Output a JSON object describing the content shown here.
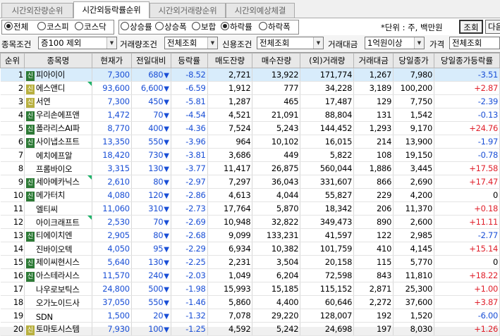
{
  "tabs": [
    {
      "label": "시간외잔량순위",
      "active": false
    },
    {
      "label": "시간외등락률순위",
      "active": true
    },
    {
      "label": "시간외거래량순위",
      "active": false
    },
    {
      "label": "시간외예상체결",
      "active": false
    }
  ],
  "market_radios": [
    {
      "label": "전체",
      "checked": true
    },
    {
      "label": "코스피",
      "checked": false
    },
    {
      "label": "코스닥",
      "checked": false
    }
  ],
  "sort_radios": [
    {
      "label": "상승률",
      "checked": false
    },
    {
      "label": "상승폭",
      "checked": false
    },
    {
      "label": "보합",
      "checked": false
    },
    {
      "label": "하락률",
      "checked": true
    },
    {
      "label": "하락폭",
      "checked": false
    }
  ],
  "unit_text": "*단위 : 주, 백만원",
  "query_button": "조회",
  "next_button": "다음",
  "filters": {
    "stock_cond_label": "종목조건",
    "stock_cond_value": "증100 제외",
    "volume_cond_label": "거래량조건",
    "volume_cond_value": "전체조회",
    "credit_cond_label": "신용조건",
    "credit_cond_value": "전체조회",
    "amount_label": "거래대금",
    "amount_value": "1억원이상",
    "price_label": "가격",
    "price_value": "전체조회"
  },
  "columns": [
    "순위",
    "종목명",
    "현재가",
    "전일대비",
    "등락률",
    "매도잔량",
    "매수잔량",
    "(외)거래량",
    "거래대금",
    "당일종가",
    "당일종가등락률"
  ],
  "rows": [
    {
      "rank": "1",
      "badge": "신",
      "badge_style": "dark",
      "name": "피아이이",
      "corner": false,
      "price": "7,300",
      "chg": "680",
      "rate": "-8.52",
      "ask": "2,721",
      "bid": "13,922",
      "vol": "171,774",
      "amt": "1,267",
      "close": "7,980",
      "close_rate": "-3.51",
      "close_color": "blue"
    },
    {
      "rank": "2",
      "badge": "신",
      "badge_style": "light",
      "name": "에스앤디",
      "corner": true,
      "price": "93,600",
      "chg": "6,600",
      "rate": "-6.59",
      "ask": "1,912",
      "bid": "777",
      "vol": "34,228",
      "amt": "3,189",
      "close": "100,200",
      "close_rate": "+2.87",
      "close_color": "red"
    },
    {
      "rank": "3",
      "badge": "신",
      "badge_style": "light",
      "name": "서연",
      "corner": false,
      "price": "7,300",
      "chg": "450",
      "rate": "-5.81",
      "ask": "1,287",
      "bid": "465",
      "vol": "17,487",
      "amt": "129",
      "close": "7,750",
      "close_rate": "-2.39",
      "close_color": "blue"
    },
    {
      "rank": "4",
      "badge": "신",
      "badge_style": "dark",
      "name": "우리손에프앤",
      "corner": false,
      "price": "1,472",
      "chg": "70",
      "rate": "-4.54",
      "ask": "4,521",
      "bid": "21,091",
      "vol": "88,804",
      "amt": "131",
      "close": "1,542",
      "close_rate": "-0.13",
      "close_color": "blue"
    },
    {
      "rank": "5",
      "badge": "신",
      "badge_style": "dark",
      "name": "폴라리스AI파",
      "corner": false,
      "price": "8,770",
      "chg": "400",
      "rate": "-4.36",
      "ask": "7,524",
      "bid": "5,243",
      "vol": "144,452",
      "amt": "1,293",
      "close": "9,170",
      "close_rate": "+24.76",
      "close_color": "red"
    },
    {
      "rank": "6",
      "badge": "신",
      "badge_style": "dark",
      "name": "사이냅소프트",
      "corner": false,
      "price": "13,350",
      "chg": "550",
      "rate": "-3.96",
      "ask": "964",
      "bid": "10,102",
      "vol": "16,015",
      "amt": "214",
      "close": "13,900",
      "close_rate": "-1.97",
      "close_color": "blue"
    },
    {
      "rank": "7",
      "badge": "",
      "badge_style": "",
      "name": "에치에프알",
      "corner": false,
      "price": "18,420",
      "chg": "730",
      "rate": "-3.81",
      "ask": "3,686",
      "bid": "449",
      "vol": "5,822",
      "amt": "108",
      "close": "19,150",
      "close_rate": "-0.78",
      "close_color": "blue"
    },
    {
      "rank": "8",
      "badge": "",
      "badge_style": "",
      "name": "프롬바이오",
      "corner": false,
      "price": "3,315",
      "chg": "130",
      "rate": "-3.77",
      "ask": "11,417",
      "bid": "26,875",
      "vol": "560,044",
      "amt": "1,886",
      "close": "3,445",
      "close_rate": "+17.58",
      "close_color": "red"
    },
    {
      "rank": "9",
      "badge": "신",
      "badge_style": "dark",
      "name": "세아메카닉스",
      "corner": true,
      "price": "2,610",
      "chg": "80",
      "rate": "-2.97",
      "ask": "7,297",
      "bid": "36,043",
      "vol": "331,607",
      "amt": "866",
      "close": "2,690",
      "close_rate": "+17.47",
      "close_color": "red"
    },
    {
      "rank": "10",
      "badge": "신",
      "badge_style": "dark",
      "name": "메가터치",
      "corner": false,
      "price": "4,080",
      "chg": "120",
      "rate": "-2.86",
      "ask": "4,613",
      "bid": "4,044",
      "vol": "55,827",
      "amt": "229",
      "close": "4,200",
      "close_rate": "0",
      "close_color": "black"
    },
    {
      "rank": "11",
      "badge": "",
      "badge_style": "",
      "name": "엘티씨",
      "corner": false,
      "price": "11,060",
      "chg": "310",
      "rate": "-2.73",
      "ask": "17,764",
      "bid": "5,870",
      "vol": "18,342",
      "amt": "206",
      "close": "11,370",
      "close_rate": "+0.18",
      "close_color": "red"
    },
    {
      "rank": "12",
      "badge": "",
      "badge_style": "",
      "name": "아이크래프트",
      "corner": true,
      "price": "2,530",
      "chg": "70",
      "rate": "-2.69",
      "ask": "10,948",
      "bid": "32,822",
      "vol": "349,473",
      "amt": "890",
      "close": "2,600",
      "close_rate": "+11.11",
      "close_color": "red"
    },
    {
      "rank": "13",
      "badge": "신",
      "badge_style": "dark",
      "name": "티에이치엔",
      "corner": false,
      "price": "2,905",
      "chg": "80",
      "rate": "-2.68",
      "ask": "9,099",
      "bid": "133,231",
      "vol": "41,597",
      "amt": "122",
      "close": "2,985",
      "close_rate": "-2.77",
      "close_color": "blue"
    },
    {
      "rank": "14",
      "badge": "",
      "badge_style": "",
      "name": "진바이오텍",
      "corner": false,
      "price": "4,050",
      "chg": "95",
      "rate": "-2.29",
      "ask": "6,934",
      "bid": "10,382",
      "vol": "101,759",
      "amt": "410",
      "close": "4,145",
      "close_rate": "+15.14",
      "close_color": "red"
    },
    {
      "rank": "15",
      "badge": "신",
      "badge_style": "dark",
      "name": "제이씨현시스",
      "corner": false,
      "price": "5,640",
      "chg": "130",
      "rate": "-2.25",
      "ask": "2,231",
      "bid": "3,504",
      "vol": "20,158",
      "amt": "115",
      "close": "5,770",
      "close_rate": "0",
      "close_color": "black"
    },
    {
      "rank": "16",
      "badge": "신",
      "badge_style": "dark",
      "name": "아스테라시스",
      "corner": false,
      "price": "11,570",
      "chg": "240",
      "rate": "-2.03",
      "ask": "1,049",
      "bid": "6,204",
      "vol": "72,598",
      "amt": "843",
      "close": "11,810",
      "close_rate": "+18.22",
      "close_color": "red"
    },
    {
      "rank": "17",
      "badge": "",
      "badge_style": "",
      "name": "나우로보틱스",
      "corner": false,
      "price": "24,800",
      "chg": "500",
      "rate": "-1.98",
      "ask": "15,993",
      "bid": "15,185",
      "vol": "115,152",
      "amt": "2,871",
      "close": "25,300",
      "close_rate": "+1.00",
      "close_color": "red"
    },
    {
      "rank": "18",
      "badge": "",
      "badge_style": "",
      "name": "오가노이드사",
      "corner": false,
      "price": "37,050",
      "chg": "550",
      "rate": "-1.46",
      "ask": "5,860",
      "bid": "4,400",
      "vol": "60,646",
      "amt": "2,272",
      "close": "37,600",
      "close_rate": "+3.87",
      "close_color": "red"
    },
    {
      "rank": "19",
      "badge": "",
      "badge_style": "",
      "name": "SDN",
      "corner": false,
      "price": "1,500",
      "chg": "20",
      "rate": "-1.32",
      "ask": "7,078",
      "bid": "29,220",
      "vol": "128,007",
      "amt": "192",
      "close": "1,520",
      "close_rate": "-6.00",
      "close_color": "blue"
    },
    {
      "rank": "20",
      "badge": "신",
      "badge_style": "light",
      "name": "토마토시스템",
      "corner": false,
      "price": "7,930",
      "chg": "100",
      "rate": "-1.25",
      "ask": "4,592",
      "bid": "5,242",
      "vol": "24,698",
      "amt": "197",
      "close": "8,030",
      "close_rate": "+1.26",
      "close_color": "red"
    }
  ],
  "colors": {
    "up": "#e0202b",
    "down": "#1a4fd6",
    "selected_row": "#d8ecfb",
    "badge_dark": "#2d7a36",
    "badge_light": "#b8b040"
  }
}
